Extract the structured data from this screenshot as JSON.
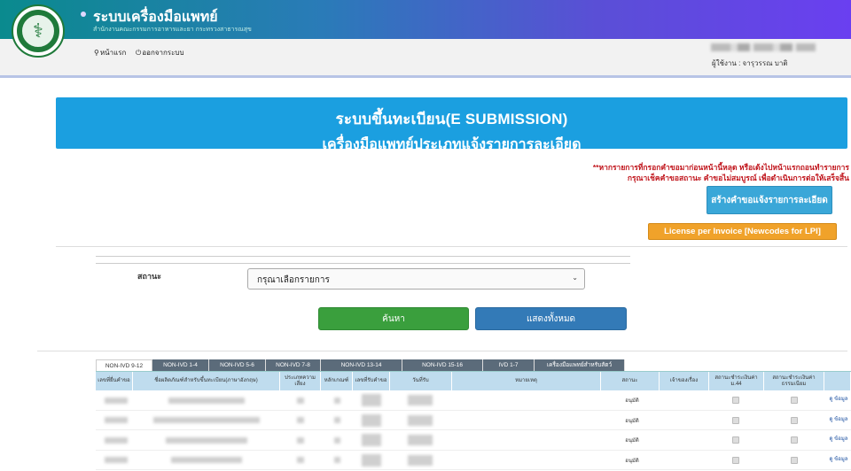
{
  "header": {
    "title": "ระบบเครื่องมือแพทย์",
    "subtitle": "สำนักงานคณะกรรมการอาหารและยา กระทรวงสาธารณสุข"
  },
  "nav": {
    "home": "หน้าแรก",
    "logout": "ออกจากระบบ"
  },
  "user": {
    "label": "ผู้ใช้งาน : จารุวรรณ บาติ"
  },
  "banner": {
    "line1": "ระบบขึ้นทะเบียน(E SUBMISSION)",
    "line2": "เครื่องมือแพทย์ประเภทแจ้งรายการละเอียด"
  },
  "warning": {
    "line1": "**หากรายการที่กรอกคำขอมาก่อนหน้านี้หลุด หรือเด้งไปหน้าแรกถอนทำรายการ",
    "line2": "กรุณาเช็คคำขอสถานะ คำขอไม่สมบูรณ์ เพื่อดำเนินการต่อให้เสร็จสิ้น"
  },
  "buttons": {
    "create": "สร้างคำขอแจ้งรายการละเอียด",
    "license": "License per Invoice [Newcodes for LPI]",
    "search": "ค้นหา",
    "show_all": "แสดงทั้งหมด"
  },
  "filter": {
    "status_label": "สถานะ",
    "status_value": "กรุณาเลือกรายการ"
  },
  "tabs": [
    "NON-IVD 9-12",
    "NON-IVD 1-4",
    "NON-IVD 5-6",
    "NON-IVD 7-8",
    "NON-IVD 13-14",
    "NON-IVD 15-16",
    "IVD 1-7",
    "เครื่องมือแพทย์สำหรับสัตว์"
  ],
  "table": {
    "headers": [
      "เลขที่ยื่นคำขอ",
      "ชื่อผลิตภัณฑ์สำหรับขึ้นทะเบียน(ภาษาอังกฤษ)",
      "ประเภทความเสี่ยง",
      "หลักเกณฑ์",
      "เลขที่รับคำขอ",
      "วันที่รับ",
      "หมายเหตุ",
      "สถานะ",
      "เจ้าของเรื่อง",
      "สถานะชำระเงินค่า ม.44",
      "สถานะชำระเงินค่าธรรมเนียม",
      ""
    ],
    "status_text": "อนุมัติ",
    "info_text": "ดู ข้อมูล",
    "row_count": 4
  }
}
